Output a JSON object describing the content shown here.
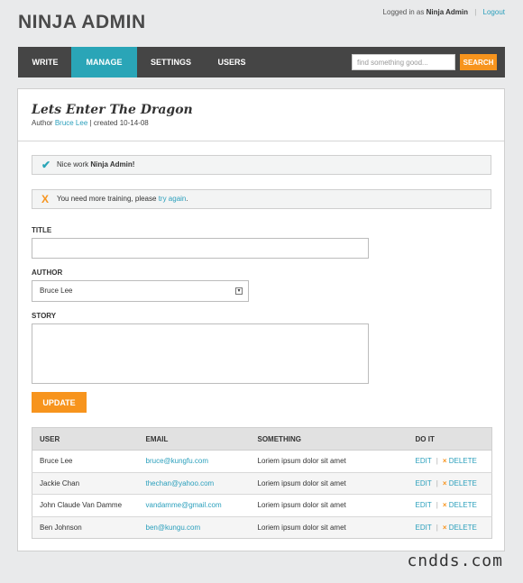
{
  "header": {
    "brand": "NINJA ADMIN",
    "logged_in_prefix": "Logged in as",
    "username": "Ninja Admin",
    "separator": "|",
    "logout": "Logout"
  },
  "nav": {
    "items": [
      {
        "label": "WRITE",
        "active": false
      },
      {
        "label": "MANAGE",
        "active": true
      },
      {
        "label": "SETTINGS",
        "active": false
      },
      {
        "label": "USERS",
        "active": false
      }
    ],
    "search_placeholder": "find something good...",
    "search_button": "SEARCH"
  },
  "post": {
    "title": "Lets Enter The Dragon",
    "author_prefix": "Author",
    "author": "Bruce Lee",
    "created": "| created 10-14-08"
  },
  "messages": {
    "success": {
      "icon": "check-icon",
      "text": "Nice work",
      "bold": "Ninja Admin!"
    },
    "error": {
      "icon": "x-icon",
      "text": "You need more training, please",
      "link": "try again",
      "suffix": "."
    }
  },
  "form": {
    "title_label": "TITLE",
    "title_value": "",
    "author_label": "AUTHOR",
    "author_value": "Bruce Lee",
    "story_label": "STORY",
    "story_value": "",
    "update_button": "UPDATE"
  },
  "table": {
    "headers": [
      "USER",
      "EMAIL",
      "SOMETHING",
      "DO IT"
    ],
    "rows": [
      {
        "user": "Bruce Lee",
        "email": "bruce@kungfu.com",
        "something": "Loriem ipsum dolor sit amet"
      },
      {
        "user": "Jackie Chan",
        "email": "thechan@yahoo.com",
        "something": "Loriem ipsum dolor sit amet"
      },
      {
        "user": "John Claude Van Damme",
        "email": "vandamme@gmail.com",
        "something": "Loriem ipsum dolor sit amet"
      },
      {
        "user": "Ben Johnson",
        "email": "ben@kungu.com",
        "something": "Loriem ipsum dolor sit amet"
      }
    ],
    "edit_label": "EDIT",
    "delete_label": "DELETE",
    "action_sep": "|",
    "delete_mark": "×"
  },
  "watermark": "cndds.com",
  "colors": {
    "accent": "#2aa5b7",
    "orange": "#f7941d",
    "nav_bg": "#454545",
    "link": "#2a9fbc"
  }
}
